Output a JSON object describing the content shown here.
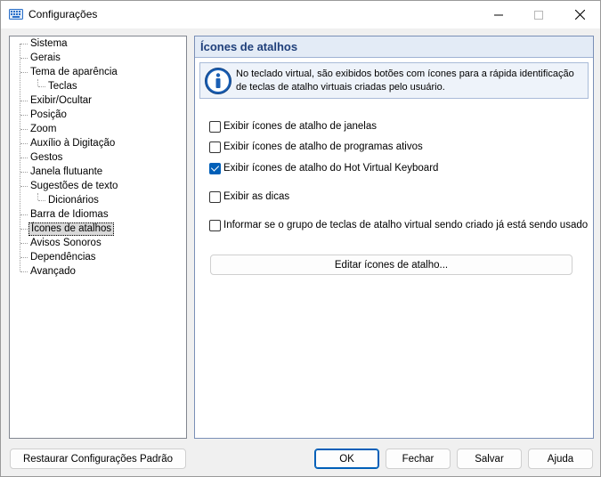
{
  "window": {
    "title": "Configurações",
    "minimize_icon": "minimize-icon",
    "maximize_icon": "maximize-icon",
    "close_icon": "close-icon"
  },
  "tree": {
    "items": [
      {
        "label": "Sistema",
        "level": 0
      },
      {
        "label": "Gerais",
        "level": 0
      },
      {
        "label": "Tema de aparência",
        "level": 0
      },
      {
        "label": "Teclas",
        "level": 1
      },
      {
        "label": "Exibir/Ocultar",
        "level": 0
      },
      {
        "label": "Posição",
        "level": 0
      },
      {
        "label": "Zoom",
        "level": 0
      },
      {
        "label": "Auxílio à Digitação",
        "level": 0
      },
      {
        "label": "Gestos",
        "level": 0
      },
      {
        "label": "Janela flutuante",
        "level": 0
      },
      {
        "label": "Sugestões de texto",
        "level": 0
      },
      {
        "label": "Dicionários",
        "level": 1
      },
      {
        "label": "Barra de Idiomas",
        "level": 0
      },
      {
        "label": "Ícones de atalhos",
        "level": 0,
        "selected": true
      },
      {
        "label": "Avisos Sonoros",
        "level": 0
      },
      {
        "label": "Dependências",
        "level": 0
      },
      {
        "label": "Avançado",
        "level": 0
      }
    ]
  },
  "panel": {
    "title": "Ícones de atalhos",
    "info_icon": "info-icon",
    "info_text": "No teclado virtual, são exibidos botões com ícones para a rápida identificação de teclas de atalho virtuais criadas pelo usuário.",
    "options": [
      {
        "label": "Exibir ícones de atalho de janelas",
        "checked": false
      },
      {
        "label": "Exibir ícones de atalho de programas ativos",
        "checked": false
      },
      {
        "label": "Exibir ícones de atalho do Hot Virtual Keyboard",
        "checked": true
      },
      {
        "label": "Exibir as dicas",
        "checked": false
      },
      {
        "label": "Informar se o grupo de teclas de atalho virtual sendo criado já está sendo usado",
        "checked": false
      }
    ],
    "edit_button": "Editar ícones de atalho..."
  },
  "footer": {
    "restore_button": "Restaurar Configurações Padrão",
    "ok_button": "OK",
    "close_button": "Fechar",
    "save_button": "Salvar",
    "help_button": "Ajuda"
  },
  "colors": {
    "accent": "#005fb8",
    "panel_header_bg": "#e3ebf6",
    "panel_title": "#1f3f7a"
  }
}
